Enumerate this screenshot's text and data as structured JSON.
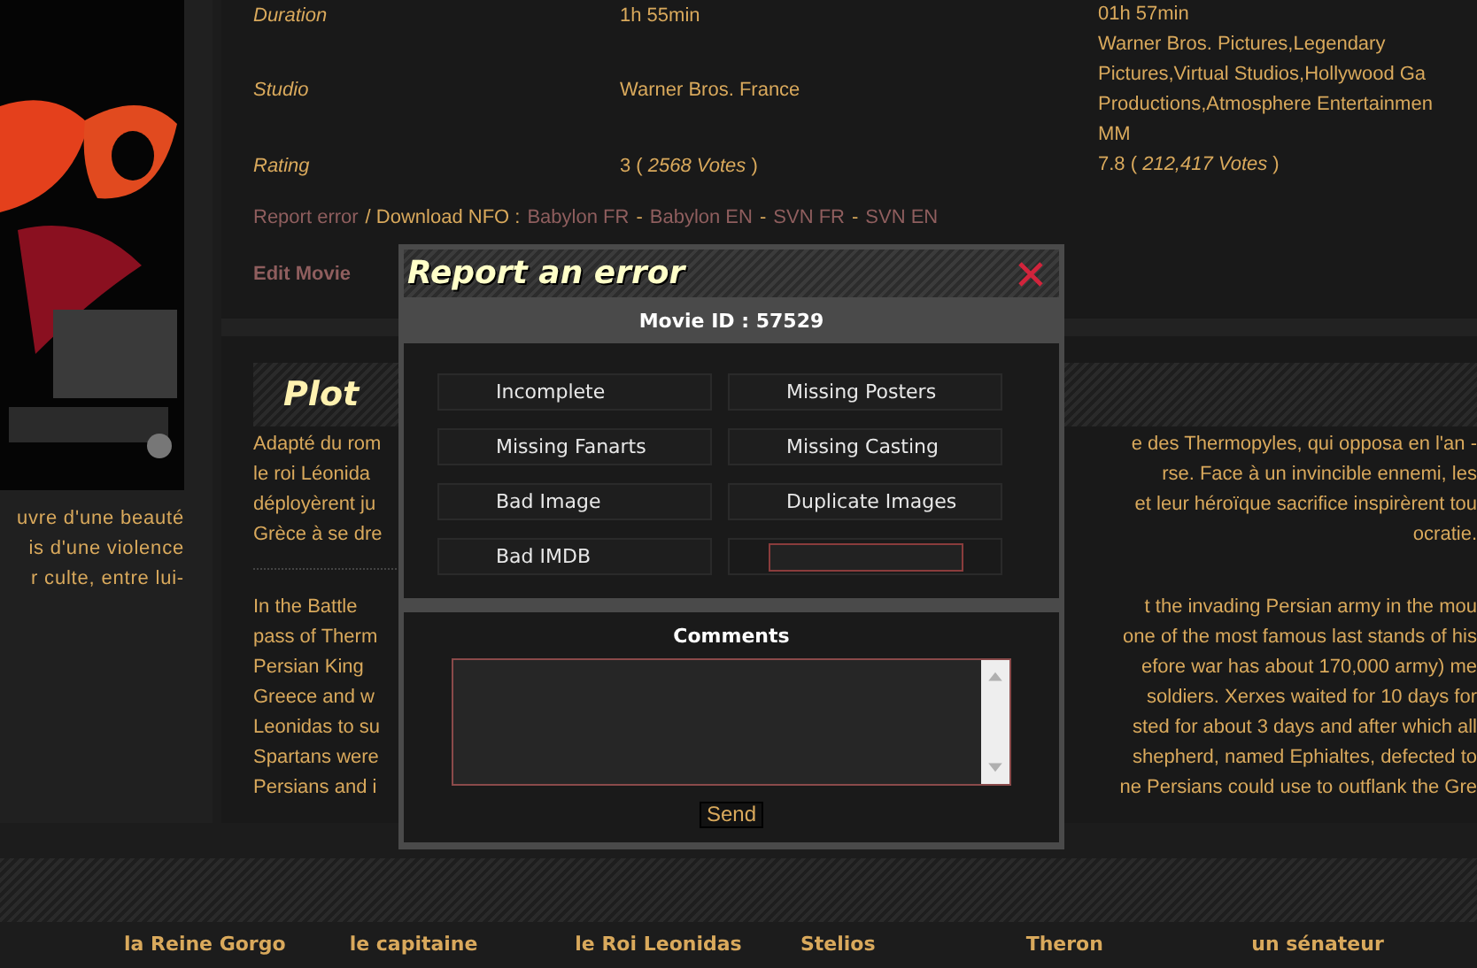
{
  "poster_column": {
    "synopsis_lines": [
      "uvre d'une beauté",
      "is d'une violence",
      "r culte, entre lui-"
    ]
  },
  "movie_info": {
    "rows": [
      {
        "label": "Duration",
        "value": "1h 55min"
      },
      {
        "label": "Studio",
        "value": "Warner Bros. France"
      },
      {
        "label": "Rating",
        "value": "3 ( *2568 Votes* )"
      }
    ],
    "external_lines": [
      "01h 57min",
      "Warner Bros. Pictures,Legendary",
      "Pictures,Virtual Studios,Hollywood Ga",
      "Productions,Atmosphere Entertainmen",
      "MM",
      "7.8 ( *212,417 Votes* )"
    ],
    "links": [
      {
        "text": "Report error",
        "kind": "link"
      },
      {
        "text": "/ Download NFO :",
        "kind": "text"
      },
      {
        "text": "Babylon FR",
        "kind": "link"
      },
      {
        "text": "-",
        "kind": "text"
      },
      {
        "text": "Babylon EN",
        "kind": "link"
      },
      {
        "text": "-",
        "kind": "text"
      },
      {
        "text": "SVN FR",
        "kind": "link"
      },
      {
        "text": "-",
        "kind": "text"
      },
      {
        "text": "SVN EN",
        "kind": "link"
      }
    ],
    "edit_link": "Edit Movie"
  },
  "plot": {
    "title": "Plot",
    "paragraphs": [
      [
        {
          "left": "Adapté du rom",
          "right": "e des Thermopyles, qui opposa en l'an -"
        },
        {
          "left": "le roi Léonida",
          "right": "rse. Face à un invincible ennemi, les"
        },
        {
          "left": "déployèrent ju",
          "right": "et leur héroïque sacrifice inspirèrent tou"
        },
        {
          "left": "Grèce à se dre",
          "right": "ocratie."
        }
      ],
      [
        {
          "left": "In the Battle",
          "right": "t the invading Persian army in the mou"
        },
        {
          "left": "pass of Therm",
          "right": "one of the most famous last stands of his"
        },
        {
          "left": "Persian King",
          "right": "efore war has about 170,000 army) me"
        },
        {
          "left": "Greece and w",
          "right": "soldiers. Xerxes waited for 10 days for"
        },
        {
          "left": "Leonidas to su",
          "right": "sted for about 3 days and after which all"
        },
        {
          "left": "Spartans were",
          "right": "shepherd, named Ephialtes, defected to"
        },
        {
          "left": "Persians and i",
          "right": "ne Persians could use to outflank the Gre"
        }
      ]
    ]
  },
  "cast": [
    "la Reine Gorgo",
    "le capitaine",
    "le Roi Leonidas",
    "Stelios",
    "Theron",
    "un sénateur"
  ],
  "report_dialog": {
    "title": "Report an error",
    "movie_id": "Movie ID : 57529",
    "options": [
      {
        "kind": "option",
        "label": "Incomplete"
      },
      {
        "kind": "option",
        "label": "Missing Posters"
      },
      {
        "kind": "option",
        "label": "Missing Fanarts"
      },
      {
        "kind": "option",
        "label": "Missing Casting"
      },
      {
        "kind": "option",
        "label": "Bad Image"
      },
      {
        "kind": "option",
        "label": "Duplicate Images"
      },
      {
        "kind": "option",
        "label": "Bad IMDB"
      },
      {
        "kind": "field"
      }
    ],
    "comments_label": "Comments",
    "send_button": "Send"
  }
}
